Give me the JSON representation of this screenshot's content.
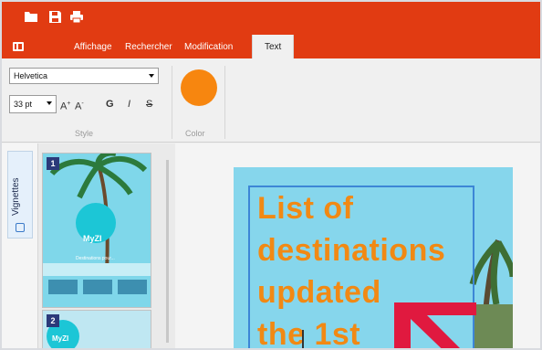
{
  "quick_access": {
    "icons": [
      "folder-open-icon",
      "save-icon",
      "print-icon"
    ]
  },
  "ribbon": {
    "tabs": [
      {
        "label": "Affichage"
      },
      {
        "label": "Rechercher"
      },
      {
        "label": "Modification"
      },
      {
        "label": "Text",
        "active": true
      }
    ],
    "style_group": {
      "font_family": "Helvetica",
      "font_size": "33 pt",
      "grow_font": "A",
      "shrink_font": "A",
      "bold": "G",
      "italic": "I",
      "strikethrough": "S",
      "label": "Style"
    },
    "color_group": {
      "label": "Color",
      "current_color": "#f7860f"
    }
  },
  "side_panel": {
    "tab_label": "Vignettes",
    "thumbnails": [
      {
        "number": "1",
        "logo": "MyZI",
        "subtitle": "Destinations pour..."
      },
      {
        "number": "2",
        "logo": "MyZI"
      }
    ]
  },
  "document": {
    "heading_lines": [
      "List of",
      "destinations",
      "updated",
      "the 1st"
    ]
  },
  "colors": {
    "accent": "#e13b12",
    "text_orange": "#f18914",
    "selection_blue": "#3d86d6"
  }
}
